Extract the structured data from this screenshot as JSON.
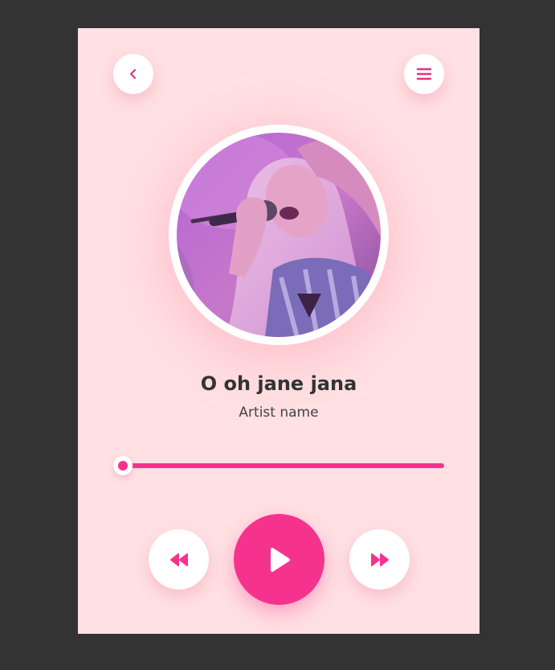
{
  "player": {
    "song_title": "O oh jane jana",
    "artist": "Artist name",
    "progress": 0.0
  },
  "controls": {
    "back_icon": "chevron-left-icon",
    "menu_icon": "hamburger-menu-icon",
    "rewind_icon": "rewind-icon",
    "play_icon": "play-icon",
    "forward_icon": "fast-forward-icon"
  },
  "colors": {
    "accent": "#f5338e",
    "background": "#ffe0e3",
    "page_background": "#333333"
  }
}
